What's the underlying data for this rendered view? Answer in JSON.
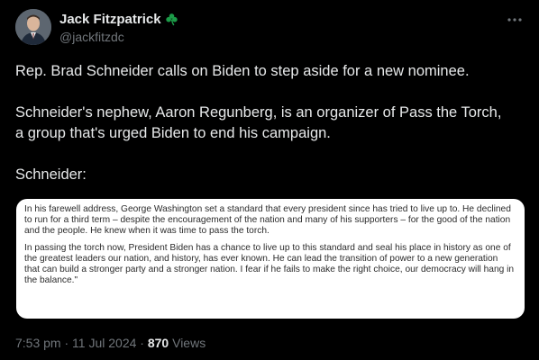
{
  "author": {
    "display_name": "Jack Fitzpatrick",
    "handle": "@jackfitzdc",
    "badge_icon": "shamrock-icon"
  },
  "menu_icon": "more-horizontal-icon",
  "tweet": {
    "lines": [
      "Rep. Brad Schneider calls on Biden to step aside for a new nominee.",
      "Schneider's nephew, Aaron Regunberg, is an organizer of Pass the Torch,",
      "a group that's urged Biden to end his campaign.",
      "Schneider:"
    ]
  },
  "quote_image": {
    "paragraphs": [
      "In his farewell address, George Washington set a standard that every president since has tried to live up to. He declined to run for a third term – despite the encouragement of the nation and many of his supporters – for the good of the nation and the people. He knew when it was time to pass the torch.",
      "In passing the torch now, President Biden has a chance to live up to this standard and seal his place in history as one of the greatest leaders our nation, and history, has ever known. He can lead the transition of power to a new generation that can build a stronger party and a stronger nation. I fear if he fails to make the right choice, our democracy will hang in the balance.\""
    ]
  },
  "meta": {
    "time": "7:53 pm",
    "separator": "·",
    "date": "11 Jul 2024",
    "views_count": "870",
    "views_label": "Views"
  },
  "colors": {
    "background": "#000000",
    "primary_text": "#e7e9ea",
    "secondary_text": "#71767b",
    "shamrock": "#1c9b48"
  }
}
